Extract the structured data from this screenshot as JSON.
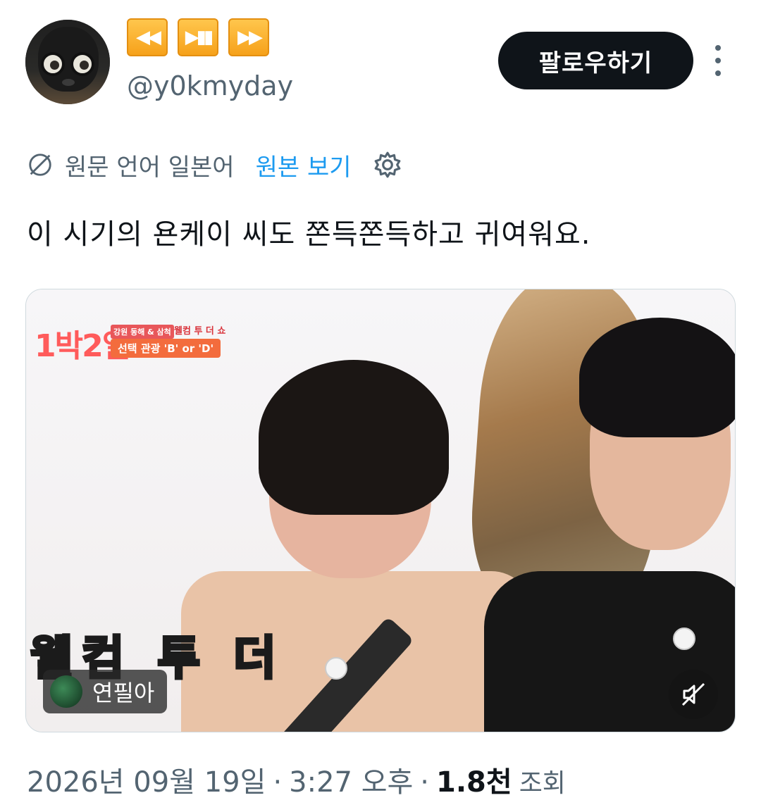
{
  "author": {
    "display_name_icons": [
      "rewind-button-emoji",
      "play-pause-button-emoji",
      "fast-forward-button-emoji"
    ],
    "handle": "@y0kmyday",
    "follow_label": "팔로우하기"
  },
  "translation": {
    "source_lang_label": "원문 언어 일본어",
    "show_original_label": "원본 보기"
  },
  "tweet": {
    "text": "이 시기의 욘케이 씨도 쫀득쫀득하고 귀여워요."
  },
  "media": {
    "logo": "1박2일",
    "tag_small": "강원 동해 & 삼척",
    "tag_title": "웰컴 투 더 쇼",
    "tag_pill": "선택 관광 'B' or 'D'",
    "caption": "웰컴 투 더",
    "uploader_name": "연필아",
    "mute_state": "muted"
  },
  "footer": {
    "date": "2026년 09월 19일",
    "separator1": "·",
    "time": "3:27 오후",
    "separator2": "·",
    "views_count": "1.8천",
    "views_label": "조회"
  },
  "colors": {
    "accent": "#1d9bf0",
    "text": "#0f1419",
    "secondary": "#536471",
    "follow_bg": "#0f1419"
  }
}
